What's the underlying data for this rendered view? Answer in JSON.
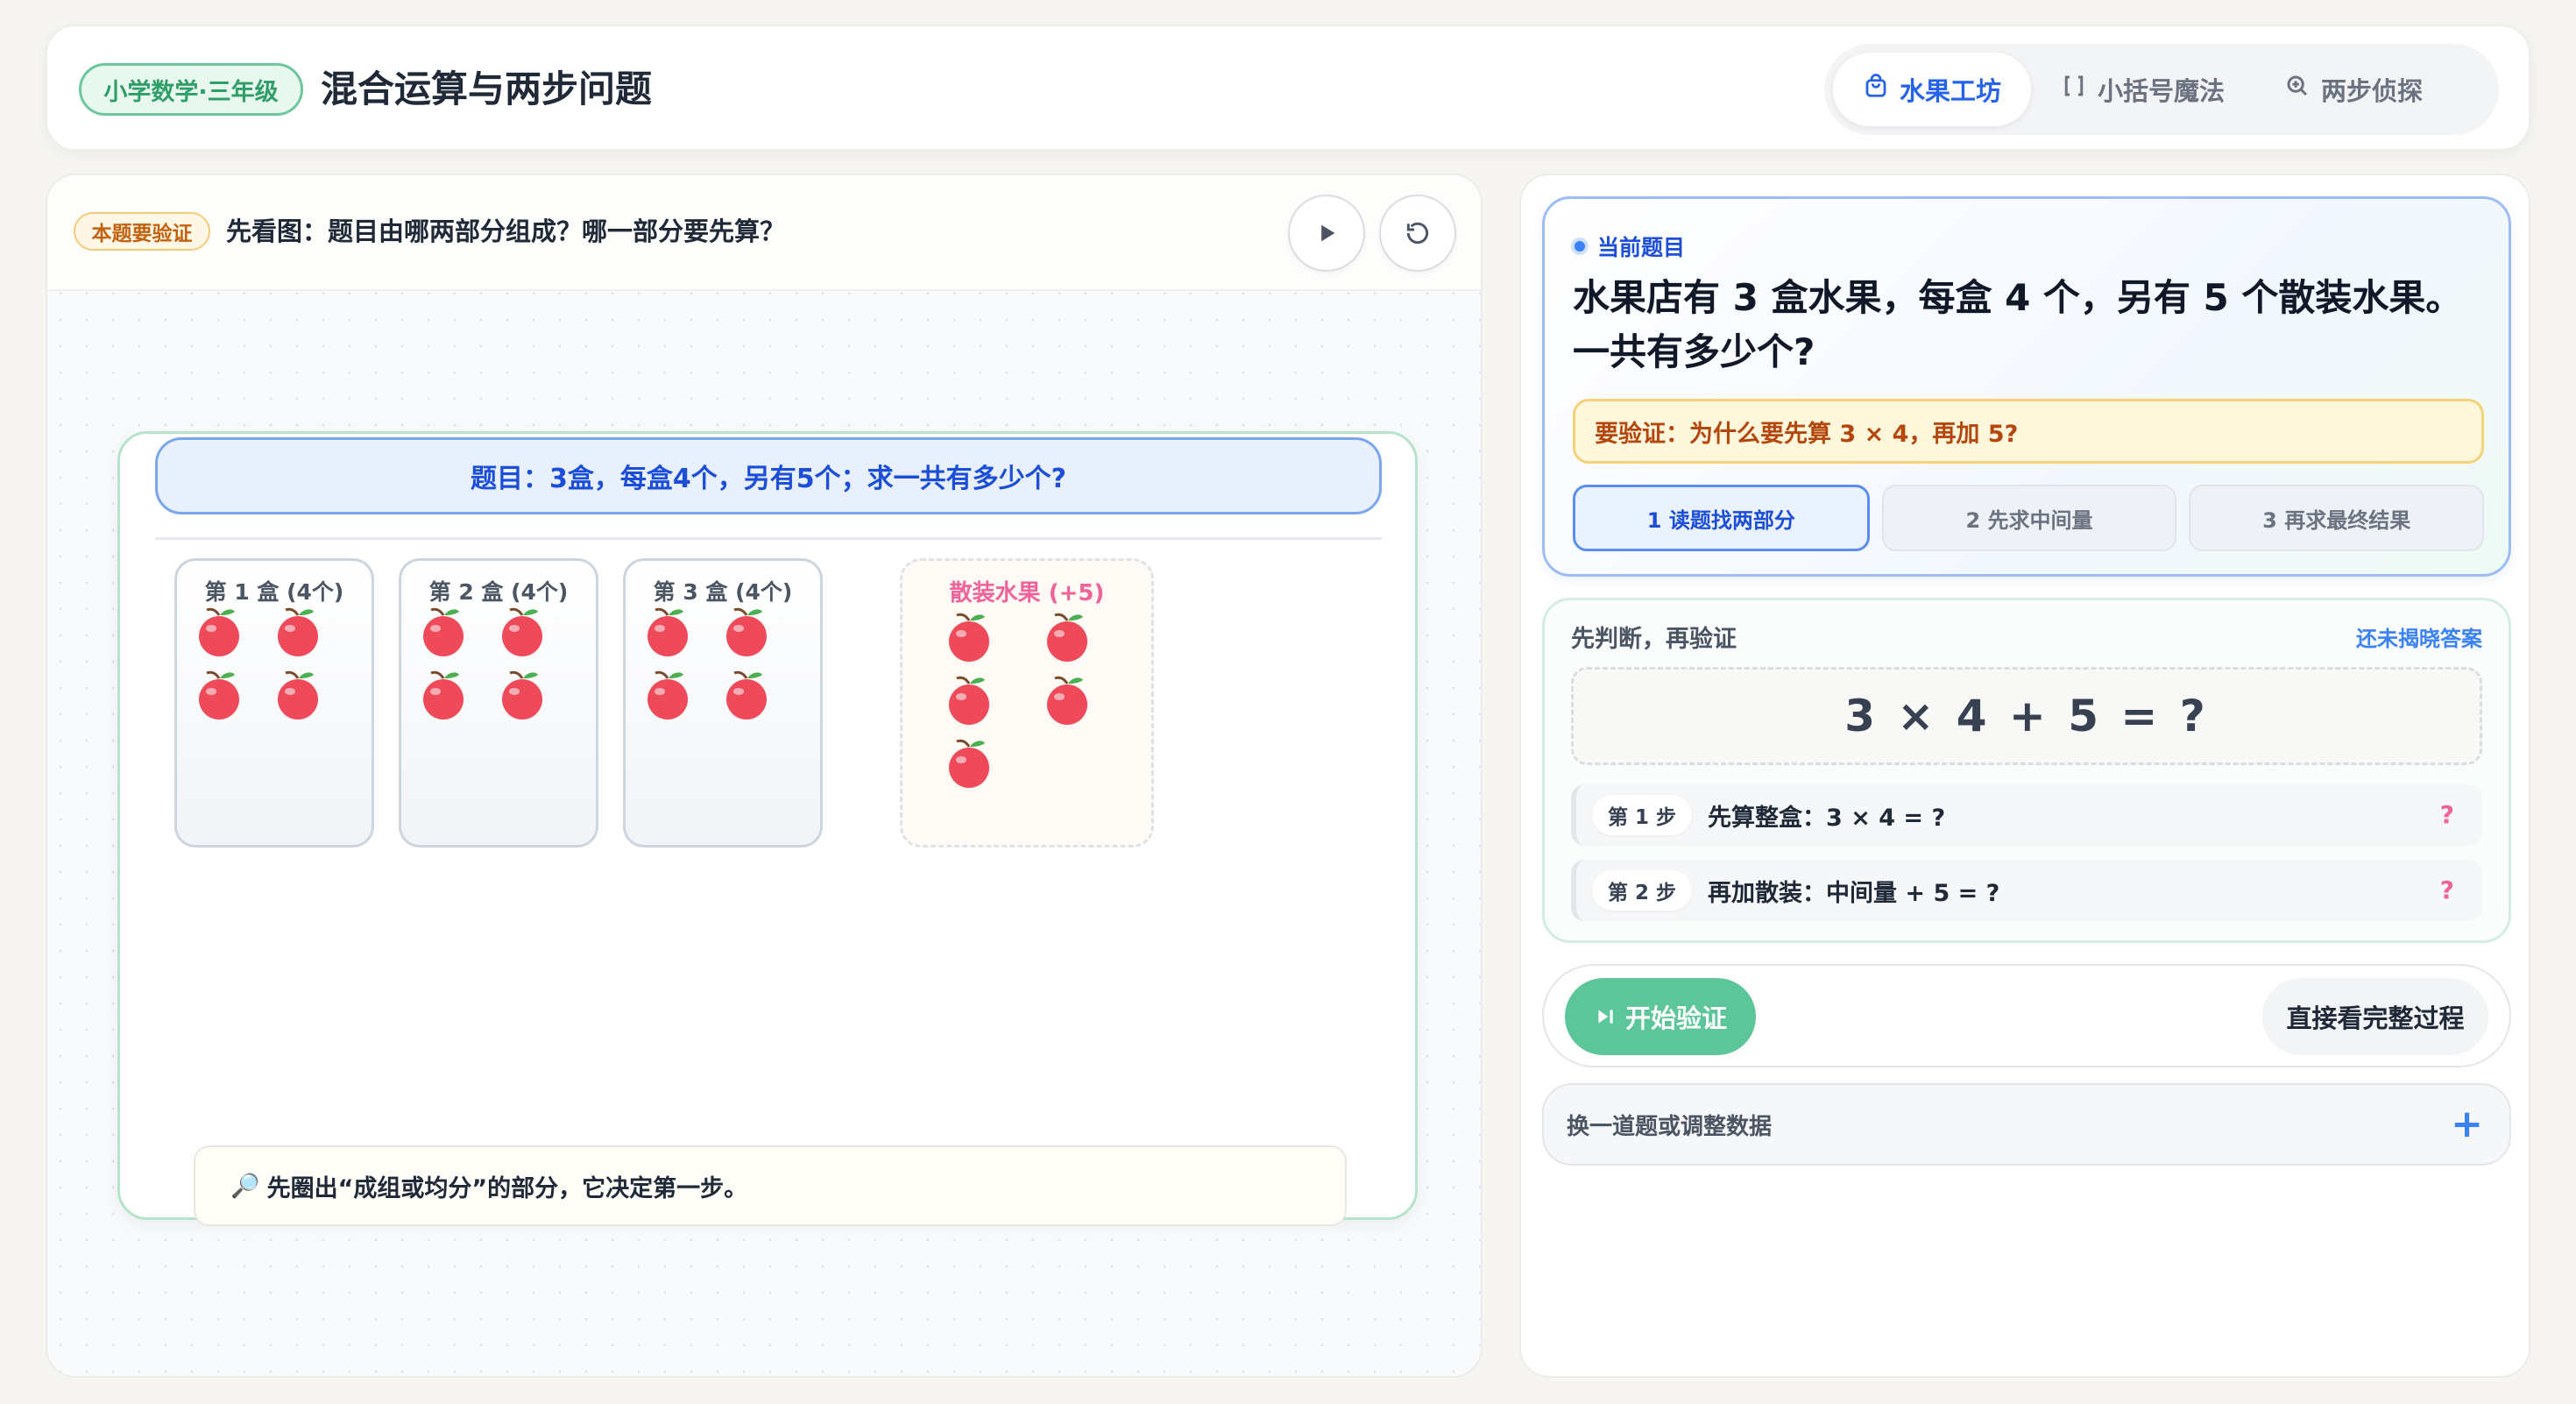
{
  "header": {
    "grade_badge": "小学数学·三年级",
    "title": "混合运算与两步问题",
    "tabs": [
      {
        "icon": "bag-icon",
        "glyph": "🛍",
        "label": "水果工坊",
        "active": true
      },
      {
        "icon": "brackets-icon",
        "glyph": "[ ]",
        "label": "小括号魔法",
        "active": false
      },
      {
        "icon": "zoom-in-icon",
        "glyph": "⊕",
        "label": "两步侦探",
        "active": false
      }
    ]
  },
  "left": {
    "verify_tag": "本题要验证",
    "hint_question": "先看图：题目由哪两部分组成？哪一部分要先算？",
    "stage": {
      "question": "题目：3盒，每盒4个，另有5个；求一共有多少个?",
      "boxes": [
        {
          "label": "第 1 盒 (4个)",
          "count": 4
        },
        {
          "label": "第 2 盒 (4个)",
          "count": 4
        },
        {
          "label": "第 3 盒 (4个)",
          "count": 4
        }
      ],
      "loose": {
        "label": "散装水果 (+5)",
        "count": 5
      },
      "tip_icon": "🔎",
      "tip": "先圈出“成组或均分”的部分，它决定第一步。"
    }
  },
  "right": {
    "current_label": "当前题目",
    "question": "水果店有 3 盒水果，每盒 4 个，另有 5 个散装水果。一共有多少个?",
    "must_verify": "要验证：为什么要先算 3 × 4，再加 5?",
    "step_tabs": [
      {
        "label": "1 读题找两部分",
        "active": true
      },
      {
        "label": "2 先求中间量",
        "active": false
      },
      {
        "label": "3 再求最终结果",
        "active": false
      }
    ],
    "judge": {
      "title": "先判断，再验证",
      "link": "还未揭晓答案",
      "expression": "3 × 4 + 5 = ?",
      "steps": [
        {
          "chip": "第 1 步",
          "desc": "先算整盒：3 × 4 = ?",
          "result": "?"
        },
        {
          "chip": "第 2 步",
          "desc": "再加散装：中间量 + 5 = ?",
          "result": "?"
        }
      ]
    },
    "actions": {
      "start": "开始验证",
      "full": "直接看完整过程"
    },
    "swap": "换一道题或调整数据"
  },
  "colors": {
    "accent_blue": "#2563eb",
    "accent_green": "#5cc59a",
    "apple_red": "#ef4a5a",
    "pink": "#f0649a"
  }
}
